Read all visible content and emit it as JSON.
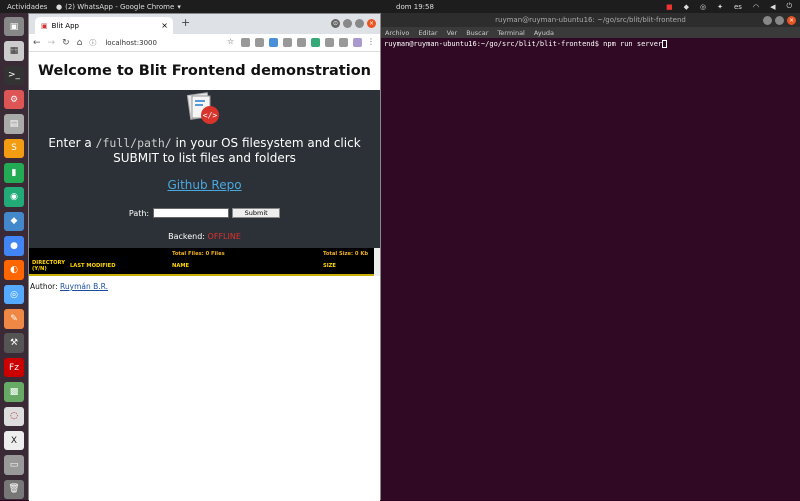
{
  "topbar": {
    "activities": "Actividades",
    "app_title": "(2) WhatsApp - Google Chrome",
    "clock": "dom 19:58",
    "lang": "es"
  },
  "dock": {
    "items": [
      "files-icon",
      "calendar-icon",
      "terminal-icon",
      "settings-icon",
      "disk-icon",
      "sublime-icon",
      "system-monitor-icon",
      "store-icon",
      "chrome-icon",
      "firefox-icon",
      "chromium-icon",
      "notes-icon",
      "tools-icon",
      "filezilla-icon",
      "app-icon",
      "draw-icon",
      "x-icon",
      "files2-icon",
      "trash-icon"
    ]
  },
  "terminal": {
    "title": "ruyman@ruyman-ubuntu16: ~/go/src/blit/blit-frontend",
    "menu": [
      "Archivo",
      "Editar",
      "Ver",
      "Buscar",
      "Terminal",
      "Ayuda"
    ],
    "prompt": "ruyman@ruyman-ubuntu16:~/go/src/blit/blit-frontend$ npm run server"
  },
  "browser": {
    "tab_title": "Blit App",
    "url": "localhost:3000"
  },
  "page": {
    "heading": "Welcome to Blit Frontend demonstration",
    "prompt_pre": "Enter a ",
    "prompt_code": "/full/path/",
    "prompt_post": " in your OS filesystem and click SUBMIT to list files and folders",
    "repo_link": "Github Repo",
    "path_label": "Path:",
    "submit_label": "Submit",
    "backend_label": "Backend:",
    "backend_status": "OFFLINE",
    "total_files": "Total Files: 0 Files",
    "total_size": "Total Size: 0 Kb",
    "columns": [
      "DIRECTORY (Y/N)",
      "LAST MODIFIED",
      "NAME",
      "SIZE"
    ],
    "author_label": "Author:",
    "author_name": "Ruymán B.R."
  },
  "colors": {
    "backend_offline": "#e03030",
    "table_header": "#ffd700",
    "terminal_bg": "#300a24"
  }
}
